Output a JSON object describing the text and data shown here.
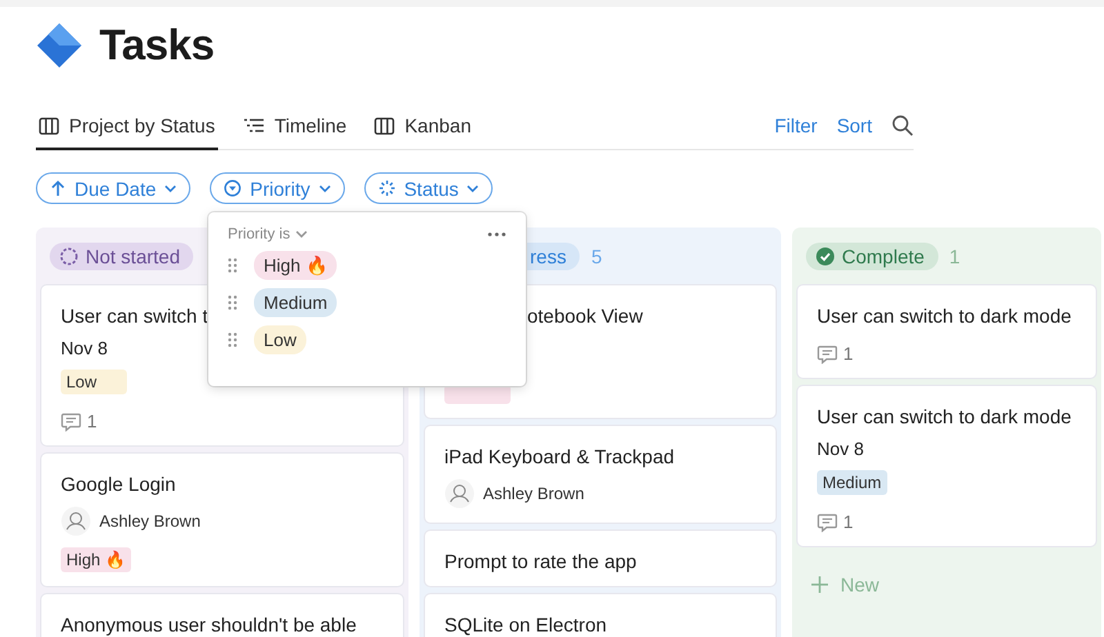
{
  "page": {
    "title": "Tasks"
  },
  "views": [
    {
      "label": "Project by Status",
      "selected": true
    },
    {
      "label": "Timeline",
      "selected": false
    },
    {
      "label": "Kanban",
      "selected": false
    }
  ],
  "actions": [
    "Filter",
    "Sort"
  ],
  "filters": [
    {
      "label": "Due Date"
    },
    {
      "label": "Priority"
    },
    {
      "label": "Status"
    }
  ],
  "columns": [
    {
      "kind": "not_started",
      "status": "Not started",
      "clipped": false,
      "cards": [
        {
          "title": "User can switch t",
          "date": "Nov 8",
          "tag": {
            "kind": "low",
            "label": "Low"
          },
          "comments": "1"
        },
        {
          "title": "Google Login",
          "assignee": "Ashley Brown",
          "tag": {
            "kind": "high",
            "label": "High 🔥"
          }
        },
        {
          "title": "Anonymous user shouldn't be able"
        }
      ]
    },
    {
      "kind": "in_progress",
      "status": "ress",
      "count": "5",
      "clipped": true,
      "cards": [
        {
          "title": "otebook View",
          "clipped": true,
          "tag": {
            "kind": "high"
          }
        },
        {
          "title": "iPad Keyboard & Trackpad",
          "assignee": "Ashley Brown"
        },
        {
          "title": "Prompt to rate the app"
        },
        {
          "title": "SQLite on Electron"
        }
      ]
    },
    {
      "kind": "complete",
      "status": "Complete",
      "count": "1",
      "clipped": false,
      "new_label": "New",
      "cards": [
        {
          "title": "User can switch to dark mode",
          "comments": "1"
        },
        {
          "title": "User can switch to dark mode",
          "date": "Nov 8",
          "tag": {
            "kind": "medium",
            "label": "Medium"
          },
          "comments": "1"
        }
      ]
    }
  ],
  "popup": {
    "label": "Priority is",
    "options": [
      {
        "kind": "high",
        "label": "High 🔥"
      },
      {
        "kind": "medium",
        "label": "Medium"
      },
      {
        "kind": "low",
        "label": "Low"
      }
    ]
  }
}
